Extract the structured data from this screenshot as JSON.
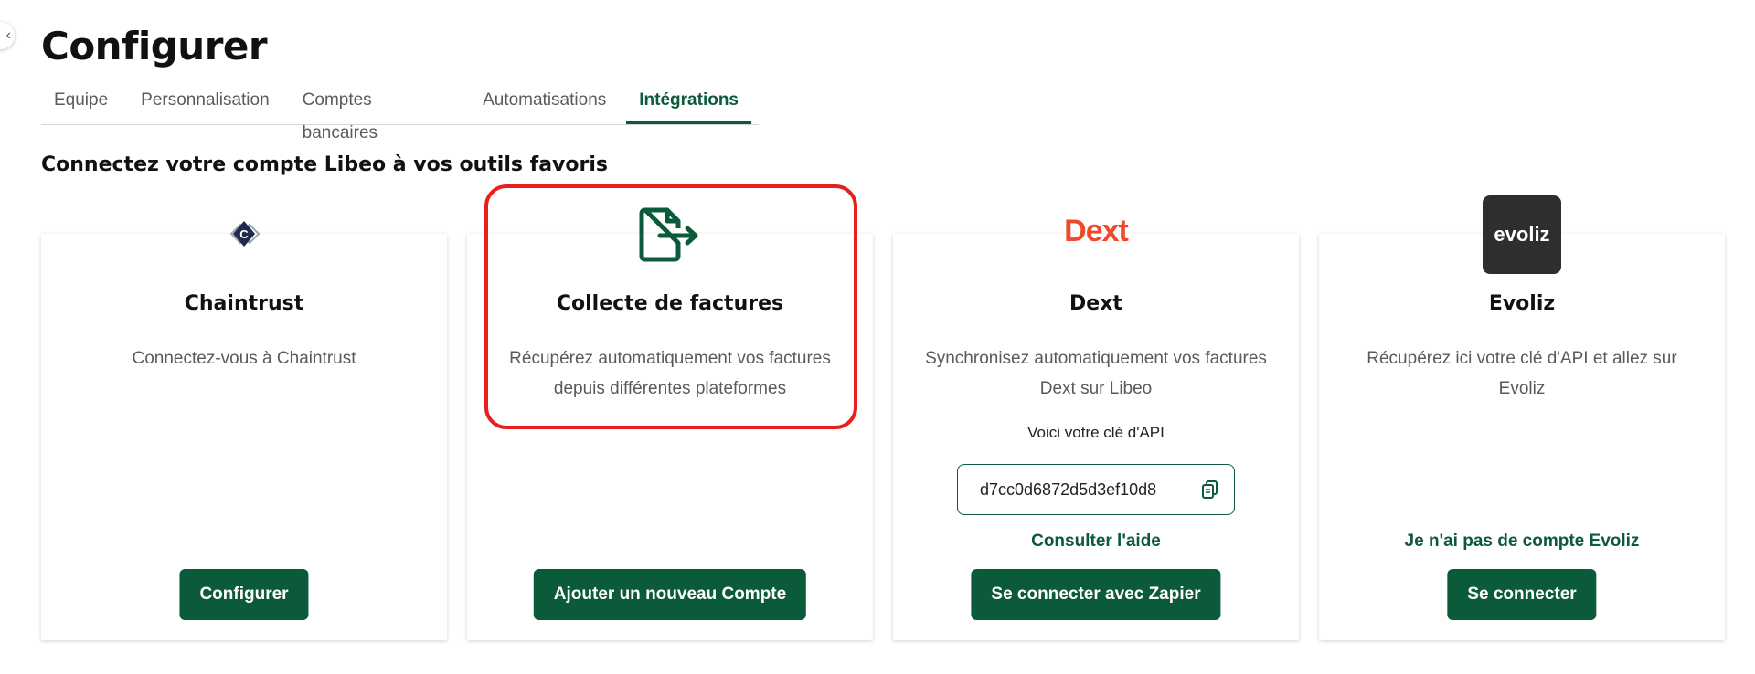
{
  "page": {
    "title": "Configurer"
  },
  "tabs": [
    {
      "label": "Equipe"
    },
    {
      "label": "Personnalisation"
    },
    {
      "label": "Comptes bancaires"
    },
    {
      "label": "Automatisations"
    },
    {
      "label": "Intégrations",
      "active": true
    }
  ],
  "section": {
    "title": "Connectez votre compte Libeo à vos outils favoris"
  },
  "cards": {
    "chaintrust": {
      "logo_icon": "chaintrust-logo-icon",
      "logo_letter": "C",
      "title": "Chaintrust",
      "description": "Connectez-vous à Chaintrust",
      "button": "Configurer"
    },
    "collecte": {
      "logo_icon": "file-export-icon",
      "title": "Collecte de factures",
      "description_line1": "Récupérez automatiquement vos factures",
      "description_line2": "depuis différentes plateformes",
      "button": "Ajouter un nouveau Compte"
    },
    "dext": {
      "logo_text": "Dext",
      "title": "Dext",
      "description_line1": "Synchronisez automatiquement vos factures",
      "description_line2": "Dext sur Libeo",
      "api_label": "Voici votre clé d'API",
      "api_key": "d7cc0d6872d5d3ef10d8",
      "copy_icon": "copy-icon",
      "help_link": "Consulter l'aide",
      "button": "Se connecter avec Zapier"
    },
    "evoliz": {
      "logo_text": "evoliz",
      "title": "Evoliz",
      "description_line1": "Récupérez ici votre clé d'API et allez sur",
      "description_line2": "Evoliz",
      "link": "Je n'ai pas de compte Evoliz",
      "button": "Se connecter"
    }
  },
  "colors": {
    "brand_green": "#0b5a3a",
    "highlight_red": "#e8201c",
    "dext_orange": "#f0492a"
  }
}
